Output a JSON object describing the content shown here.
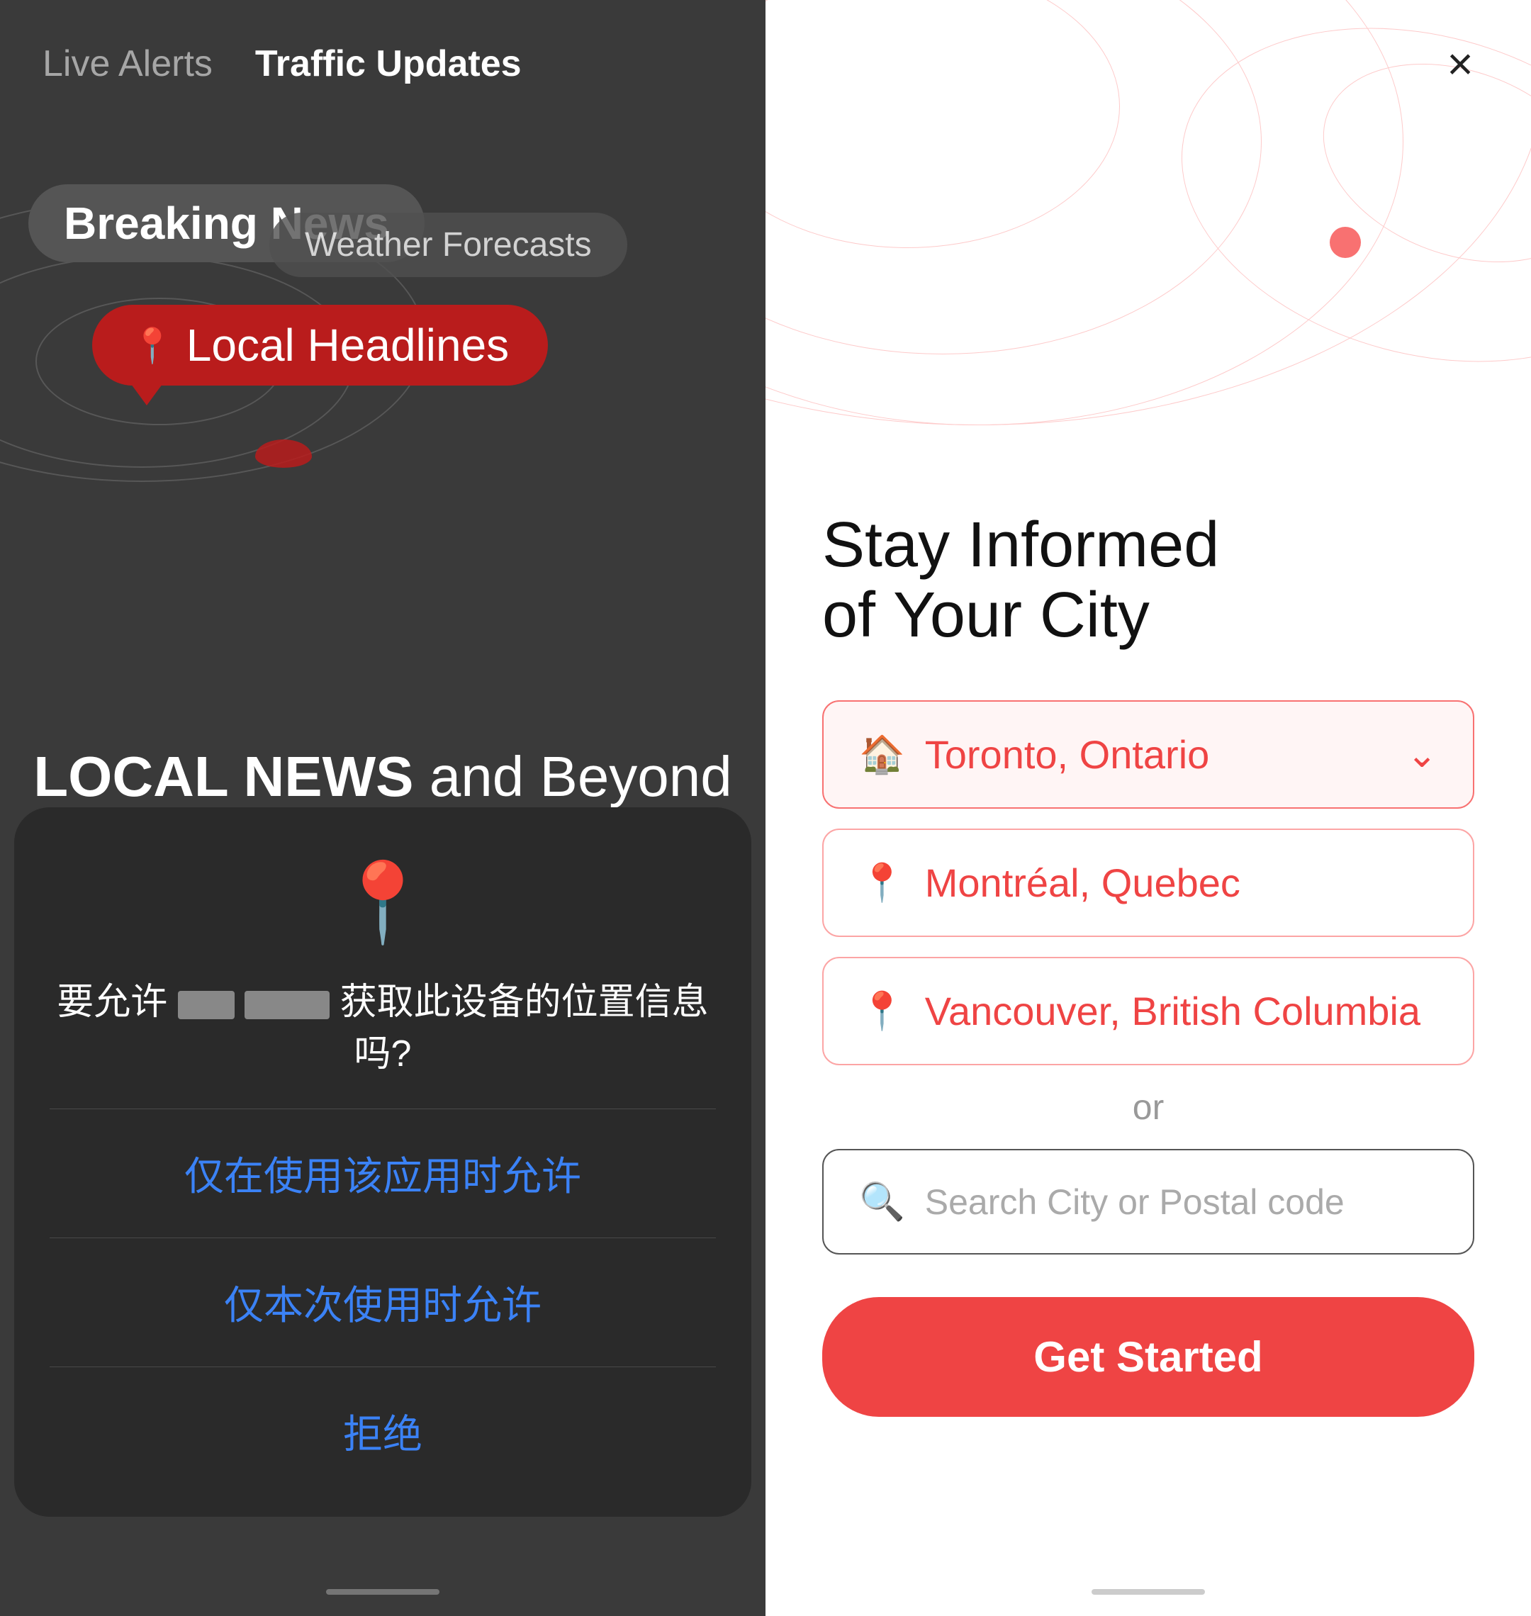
{
  "left": {
    "nav": {
      "live_alerts": "Live Alerts",
      "traffic_updates": "Traffic Updates"
    },
    "breaking_news": "Breaking News",
    "weather_forecasts": "Weather Forecasts",
    "local_headlines": "Local Headlines",
    "local_news_title_bold": "LOCAL NEWS",
    "local_news_title_light": "and Beyond",
    "dialog": {
      "question_prefix": "要允许",
      "question_suffix": "获取此设备的位置信息吗?",
      "option1": "仅在使用该应用时允许",
      "option2": "仅本次使用时允许",
      "option3": "拒绝"
    }
  },
  "right": {
    "close_label": "×",
    "headline_light": "Stay Informed",
    "headline_of": "of",
    "headline_bold": "Your City",
    "cities": [
      {
        "name": "Toronto, Ontario",
        "selected": true,
        "icon_type": "home"
      },
      {
        "name": "Montréal, Quebec",
        "selected": false,
        "icon_type": "pin"
      },
      {
        "name": "Vancouver, British Columbia",
        "selected": false,
        "icon_type": "pin"
      }
    ],
    "or_label": "or",
    "search_placeholder": "Search City or Postal code",
    "get_started_label": "Get Started"
  }
}
